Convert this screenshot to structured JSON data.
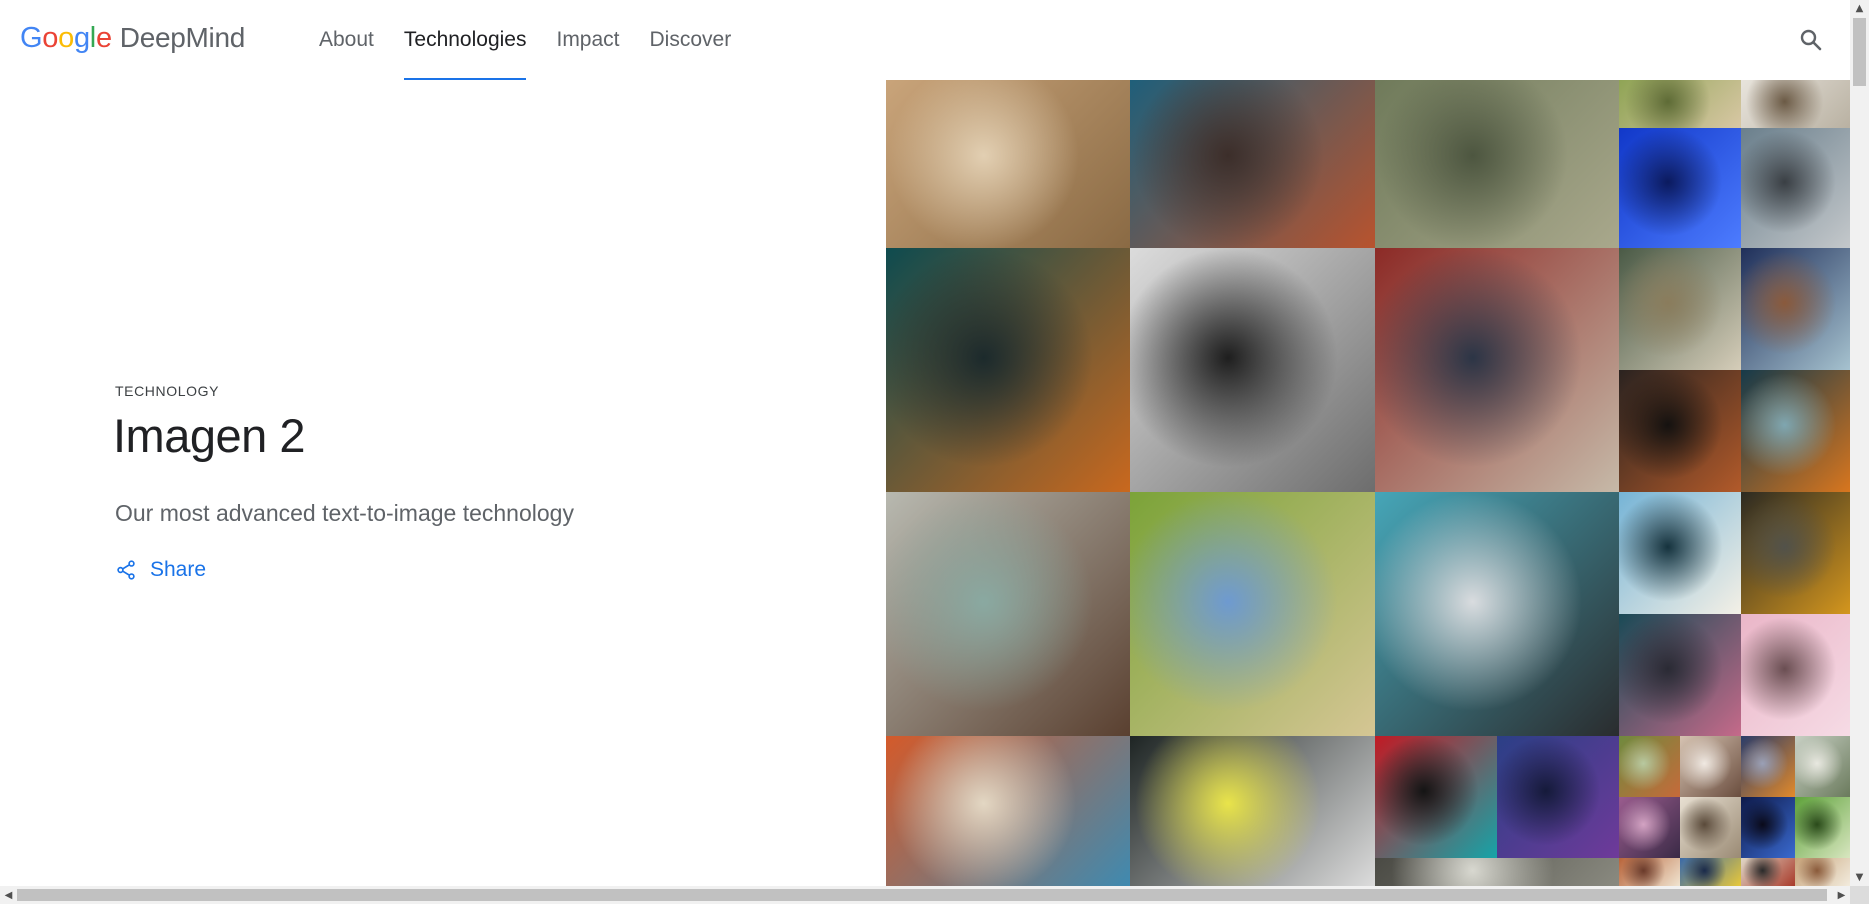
{
  "header": {
    "logo": {
      "google_letters": [
        "G",
        "o",
        "o",
        "g",
        "l",
        "e"
      ],
      "product": "DeepMind"
    },
    "nav": [
      {
        "label": "About",
        "active": false
      },
      {
        "label": "Technologies",
        "active": true
      },
      {
        "label": "Impact",
        "active": false
      },
      {
        "label": "Discover",
        "active": false
      }
    ],
    "search_icon": "search-icon"
  },
  "hero": {
    "eyebrow": "TECHNOLOGY",
    "title": "Imagen 2",
    "subtitle": "Our most advanced text-to-image technology",
    "share_label": "Share",
    "share_icon": "share-icon"
  },
  "mosaic": {
    "tiles": [
      {
        "name": "giraffe-zebra-image",
        "colors": [
          "#c9a47a",
          "#8a6a44",
          "#e2cfb2"
        ]
      },
      {
        "name": "woman-portrait-painting-image",
        "colors": [
          "#1f5f7a",
          "#b8532e",
          "#3c2e2a"
        ]
      },
      {
        "name": "robot-in-field-image",
        "colors": [
          "#6f7a5a",
          "#a9a88c",
          "#4d5640"
        ]
      },
      {
        "name": "man-smiling-green-image",
        "colors": [
          "#8fa455",
          "#d8c7a4",
          "#5e6b36"
        ]
      },
      {
        "name": "chair-room-image",
        "colors": [
          "#e8e4dc",
          "#b9b1a2",
          "#6b5a45"
        ]
      },
      {
        "name": "blue-concert-image",
        "colors": [
          "#1138c9",
          "#4d7cff",
          "#0b1a5e"
        ]
      },
      {
        "name": "bike-street-image",
        "colors": [
          "#6a7f8c",
          "#c4c8cb",
          "#3a3f44"
        ]
      },
      {
        "name": "alley-night-image",
        "colors": [
          "#0e4b4f",
          "#c9681e",
          "#1c2a2c"
        ]
      },
      {
        "name": "elderly-couple-image",
        "colors": [
          "#dcdcdc",
          "#6d6d6d",
          "#1e1e1e"
        ]
      },
      {
        "name": "hand-waving-taxi-image",
        "colors": [
          "#8c2a26",
          "#c6b9a8",
          "#2c3546"
        ]
      },
      {
        "name": "green-armchairs-image",
        "colors": [
          "#4a5a46",
          "#d5cdb9",
          "#8a7c5c"
        ]
      },
      {
        "name": "blueberries-bowl-image",
        "colors": [
          "#1f2f5a",
          "#a6c2cf",
          "#8a5a3c"
        ]
      },
      {
        "name": "night-alley-image",
        "colors": [
          "#2b2320",
          "#b25a2a",
          "#151210"
        ]
      },
      {
        "name": "pixel-fox-image",
        "colors": [
          "#163a4a",
          "#d8761e",
          "#7fa6b0"
        ]
      },
      {
        "name": "young-man-portrait-image",
        "colors": [
          "#b8b9b0",
          "#5a4030",
          "#8aa9a1"
        ]
      },
      {
        "name": "green-hills-horses-image",
        "colors": [
          "#7ba338",
          "#d5c694",
          "#6e9ad0"
        ]
      },
      {
        "name": "cyclists-race-image",
        "colors": [
          "#46a6b8",
          "#2a2c2e",
          "#d9dcdf"
        ]
      },
      {
        "name": "clouds-sea-image",
        "colors": [
          "#76b4d6",
          "#f4f0e6",
          "#15323d"
        ]
      },
      {
        "name": "house-night-image",
        "colors": [
          "#2c2a22",
          "#d4961e",
          "#52524a"
        ]
      },
      {
        "name": "teal-flowers-image",
        "colors": [
          "#1a4a56",
          "#c56a8a",
          "#2a2a34"
        ]
      },
      {
        "name": "cherry-blossom-image",
        "colors": [
          "#eab6c8",
          "#f6dbe5",
          "#6a4e52"
        ]
      },
      {
        "name": "city-painting-image",
        "colors": [
          "#d45a2a",
          "#3f8ab0",
          "#e3d7c3"
        ]
      },
      {
        "name": "sneaker-closeup-image",
        "colors": [
          "#1e2524",
          "#dcdcdc",
          "#e9e44a"
        ]
      },
      {
        "name": "red-teal-face-image",
        "colors": [
          "#c11a24",
          "#16a4a8",
          "#141414"
        ]
      },
      {
        "name": "blue-club-image",
        "colors": [
          "#2b3f86",
          "#6f3a9a",
          "#151a3a"
        ]
      },
      {
        "name": "robin-bird-image",
        "colors": [
          "#6f8a3e",
          "#c66a3a",
          "#b8c9a0"
        ]
      },
      {
        "name": "hands-ring-image",
        "colors": [
          "#d6c3b2",
          "#6a4d3e",
          "#f0e9e2"
        ]
      },
      {
        "name": "cat-orange-image",
        "colors": [
          "#2a3c6a",
          "#e38a2a",
          "#9aa0b6"
        ]
      },
      {
        "name": "white-house-image",
        "colors": [
          "#c8d0c4",
          "#6a7a5c",
          "#e8e8e0"
        ]
      },
      {
        "name": "pink-lake-image",
        "colors": [
          "#9a5c8e",
          "#3a2a46",
          "#d3a3c3"
        ]
      },
      {
        "name": "cat-drawing-image",
        "colors": [
          "#e8e0d2",
          "#9a8a74",
          "#5a4a3a"
        ]
      },
      {
        "name": "comet-sky-image",
        "colors": [
          "#0e1a4a",
          "#3a6ad0",
          "#0a0a1a"
        ]
      },
      {
        "name": "green-frog-image",
        "colors": [
          "#5ea23a",
          "#d8e6c0",
          "#2a4a1a"
        ]
      },
      {
        "name": "orange-toy-image",
        "colors": [
          "#b8643a",
          "#f0e4d0",
          "#6a3a2a"
        ]
      },
      {
        "name": "tennis-court-image",
        "colors": [
          "#3a6aa8",
          "#e8c83a",
          "#1a2a4a"
        ]
      },
      {
        "name": "poster-image",
        "colors": [
          "#e0d8c8",
          "#a83a2a",
          "#2a2a2a"
        ]
      },
      {
        "name": "food-plate-image",
        "colors": [
          "#c8a47a",
          "#f2ebdd",
          "#8a5a3a"
        ]
      },
      {
        "name": "bottom-partial-image",
        "colors": [
          "#4a4a44",
          "#8a8a80",
          "#d8d8d0"
        ]
      }
    ]
  },
  "scrollbars": {
    "up": "▲",
    "down": "▼",
    "left": "◀",
    "right": "▶"
  }
}
